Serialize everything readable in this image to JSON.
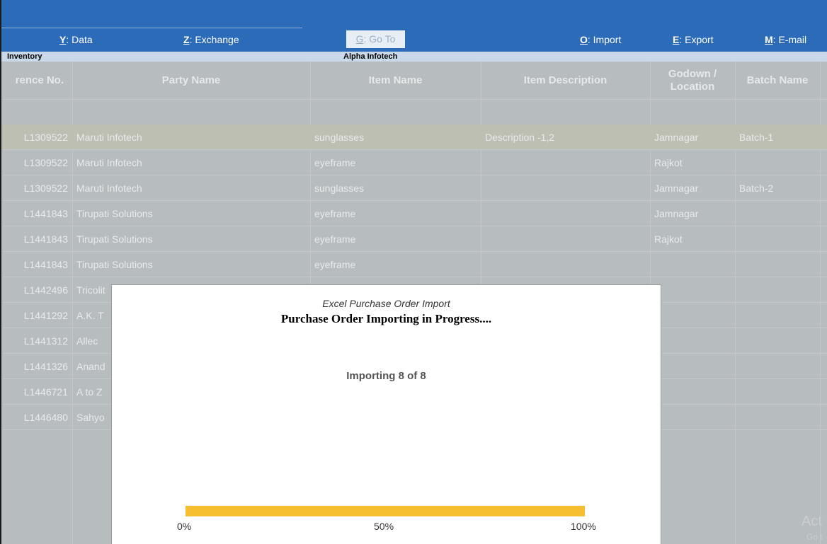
{
  "menu": {
    "data": {
      "key": "Y",
      "label": "Data"
    },
    "exchange": {
      "key": "Z",
      "label": "Exchange"
    },
    "goto": {
      "key": "G",
      "label": "Go To"
    },
    "import": {
      "key": "O",
      "label": "Import"
    },
    "export": {
      "key": "E",
      "label": "Export"
    },
    "email": {
      "key": "M",
      "label": "E-mail"
    }
  },
  "infobar": {
    "left": "Inventory",
    "company": "Alpha Infotech"
  },
  "table": {
    "headers": [
      "rence No.",
      "Party Name",
      "Item Name",
      "Item Description",
      "Godown / Location",
      "Batch Name"
    ],
    "rows": [
      [
        "L1309522",
        "Maruti Infotech",
        "sunglasses",
        "Description -1,2",
        "Jamnagar",
        "Batch-1"
      ],
      [
        "L1309522",
        "Maruti Infotech",
        "eyeframe",
        "",
        "Rajkot",
        ""
      ],
      [
        "L1309522",
        "Maruti Infotech",
        "sunglasses",
        "",
        "Jamnagar",
        "Batch-2"
      ],
      [
        "L1441843",
        "Tirupati Solutions",
        "eyeframe",
        "",
        "Jamnagar",
        ""
      ],
      [
        "L1441843",
        "Tirupati Solutions",
        "eyeframe",
        "",
        "Rajkot",
        ""
      ],
      [
        "L1441843",
        "Tirupati Solutions",
        "eyeframe",
        "",
        "",
        ""
      ],
      [
        "L1442496",
        "Tricolit",
        "",
        "",
        "",
        ""
      ],
      [
        "L1441292",
        "A.K. T",
        "",
        "",
        "",
        ""
      ],
      [
        "L1441312",
        "Allec",
        "",
        "",
        "",
        ""
      ],
      [
        "L1441326",
        "Anand",
        "",
        "",
        "",
        ""
      ],
      [
        "L1446721",
        "A to Z",
        "",
        "",
        "",
        ""
      ],
      [
        "L1446480",
        "Sahyo",
        "",
        "",
        "",
        ""
      ]
    ]
  },
  "dialog": {
    "caption": "Excel Purchase Order Import",
    "title": "Purchase Order Importing in Progress....",
    "status": "Importing 8 of 8",
    "progress": 1.0,
    "ticks": [
      "0%",
      "50%",
      "100%"
    ]
  },
  "watermark": {
    "line1": "Act",
    "line2": "Go t"
  },
  "colors": {
    "topbar": "#2c6bb7",
    "progress": "#f5bf30",
    "overlay": "#b7bcbf"
  }
}
